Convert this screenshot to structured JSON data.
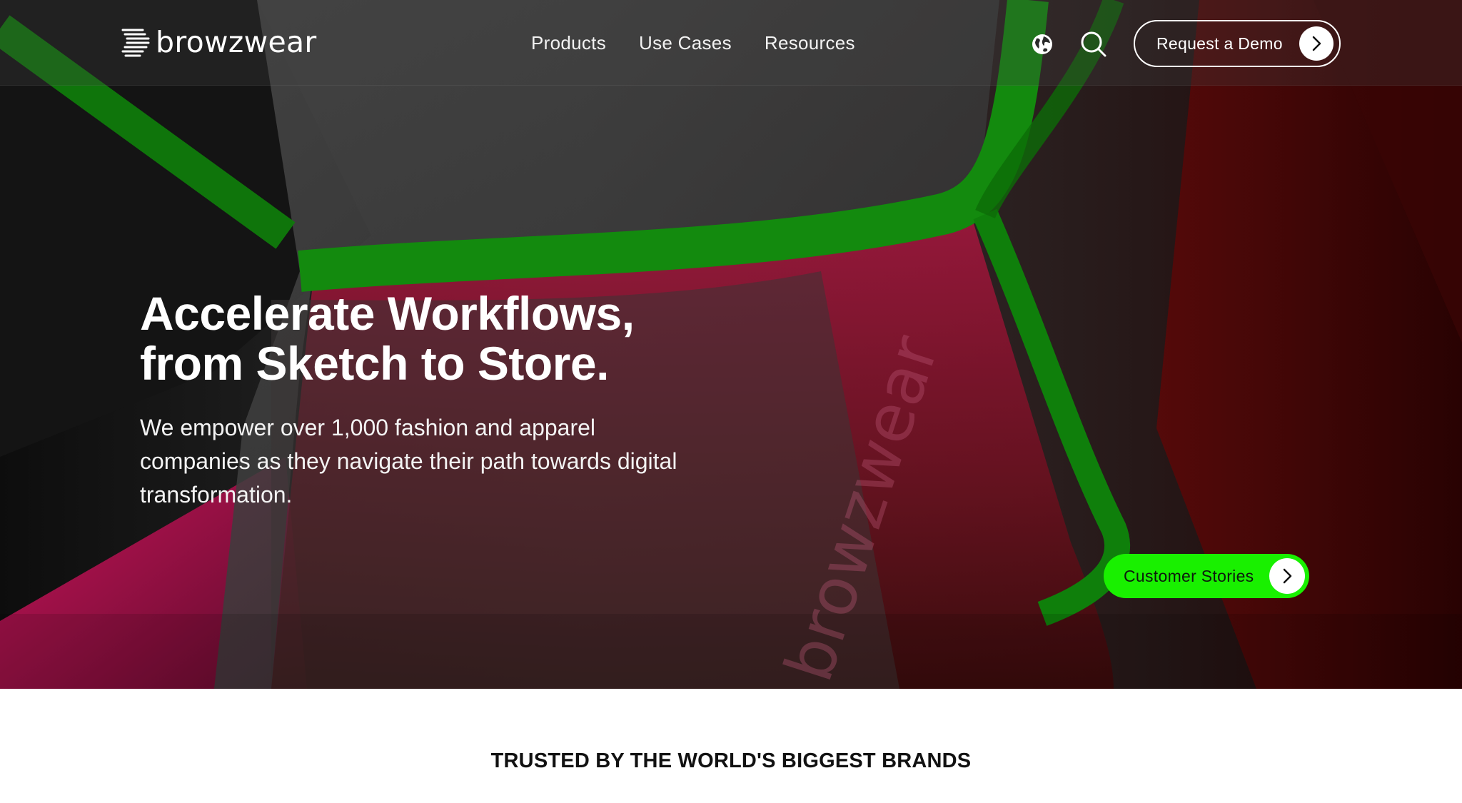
{
  "brand": {
    "name": "browzwear",
    "watermark": "browzwear"
  },
  "nav": {
    "items": [
      {
        "label": "Products"
      },
      {
        "label": "Use Cases"
      },
      {
        "label": "Resources"
      }
    ]
  },
  "header": {
    "language_icon": "globe-icon",
    "search_icon": "search-icon",
    "demo_button_label": "Request a Demo",
    "demo_button_icon": "chevron-right-icon"
  },
  "hero": {
    "headline_line1": "Accelerate Workflows,",
    "headline_line2": "from Sketch to Store.",
    "description": "We empower over 1,000 fashion and apparel companies as they navigate their path towards digital transformation.",
    "cta_label": "Customer Stories",
    "cta_icon": "chevron-right-icon"
  },
  "trusted": {
    "heading": "TRUSTED BY THE WORLD'S BIGGEST BRANDS"
  },
  "colors": {
    "accent_green": "#19f000",
    "garment_green": "#138a0e",
    "garment_magenta": "#b3124f",
    "garment_red": "#5a0a0a",
    "white": "#ffffff"
  }
}
